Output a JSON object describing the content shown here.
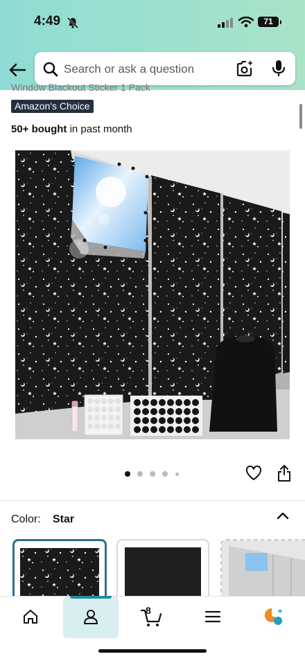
{
  "status_bar": {
    "time": "4:49",
    "battery": "71"
  },
  "search": {
    "placeholder": "Search or ask a question"
  },
  "product": {
    "title_cut": "Window Blackout Sticker 1 Pack",
    "badge": "Amazon's Choice",
    "bought_bold": "50+ bought",
    "bought_rest": " in past month",
    "image_count": 5,
    "active_image_index": 0
  },
  "color": {
    "label": "Color:",
    "value": "Star"
  },
  "swatches": [
    "Star",
    "Black",
    "Window"
  ],
  "nav": {
    "cart_count": "8",
    "items": [
      "home",
      "account",
      "cart",
      "menu",
      "rufus"
    ]
  },
  "colors": {
    "header_gradient_start": "#8fdcd4",
    "header_gradient_end": "#a9e3c8",
    "badge_bg": "#232f3e",
    "active_accent": "#1e8fa0",
    "rufus_orange": "#f08a24",
    "rufus_teal": "#1aa3b8"
  }
}
